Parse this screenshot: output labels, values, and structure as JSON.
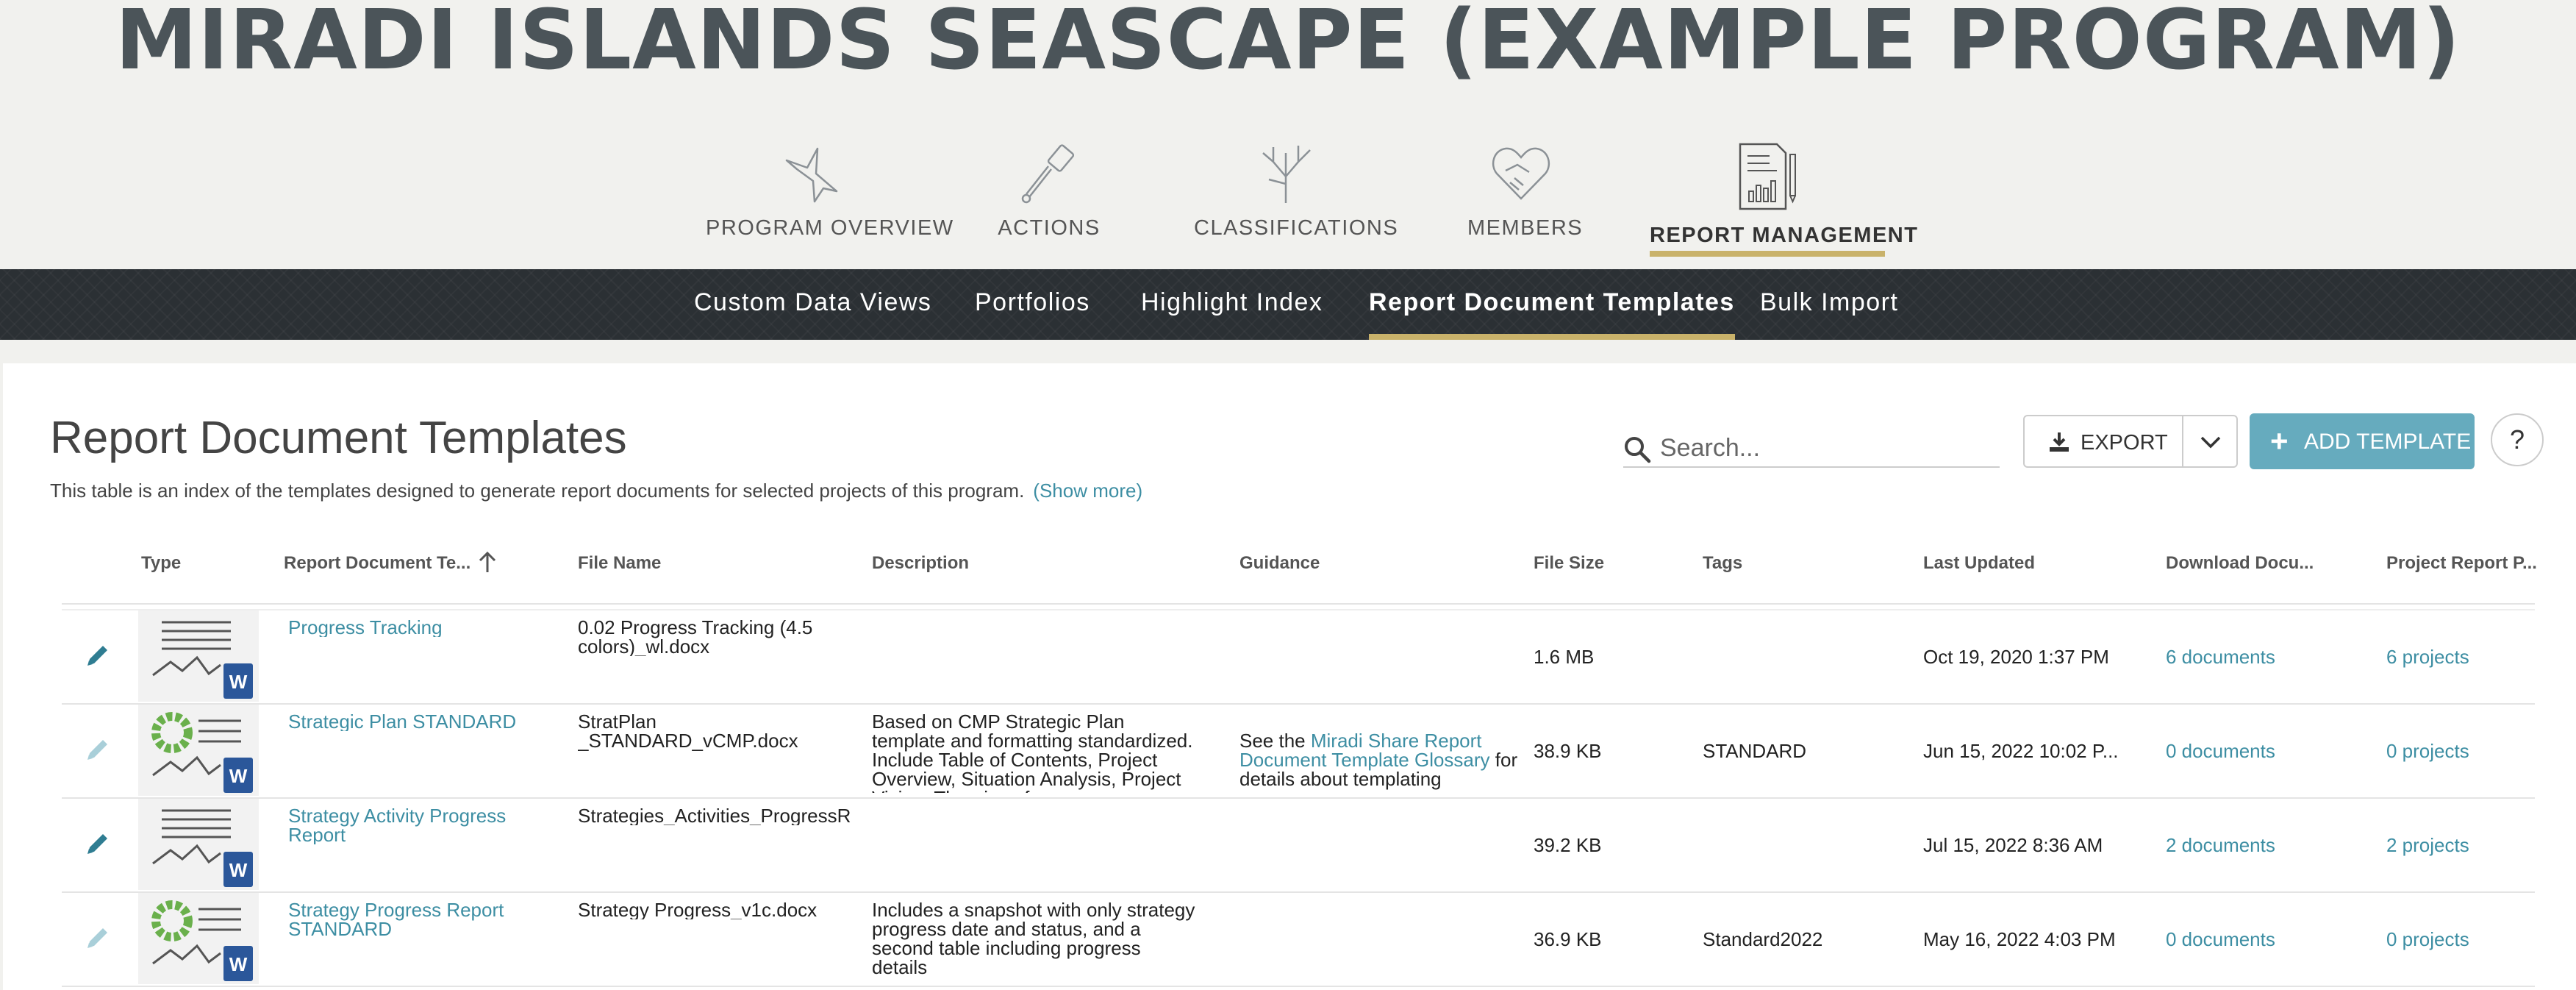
{
  "program_title": "MIRADI ISLANDS SEASCAPE (EXAMPLE PROGRAM)",
  "main_nav": [
    {
      "label": "PROGRAM OVERVIEW",
      "icon": "bird-icon"
    },
    {
      "label": "ACTIONS",
      "icon": "trowel-icon"
    },
    {
      "label": "CLASSIFICATIONS",
      "icon": "branches-icon"
    },
    {
      "label": "MEMBERS",
      "icon": "handshake-icon"
    },
    {
      "label": "REPORT MANAGEMENT",
      "icon": "report-icon",
      "active": true
    }
  ],
  "sub_nav": [
    {
      "label": "Custom Data Views"
    },
    {
      "label": "Portfolios"
    },
    {
      "label": "Highlight Index"
    },
    {
      "label": "Report Document Templates",
      "active": true
    },
    {
      "label": "Bulk Import"
    }
  ],
  "page": {
    "title": "Report Document Templates",
    "description": "This table is an index of the templates designed to generate report documents for selected projects of this program.",
    "show_more": "(Show more)"
  },
  "toolbar": {
    "search_placeholder": "Search...",
    "export_label": "EXPORT",
    "add_label": "ADD TEMPLATE",
    "help_label": "?"
  },
  "table": {
    "columns": [
      "Type",
      "Report Document Te...",
      "File Name",
      "Description",
      "Guidance",
      "File Size",
      "Tags",
      "Last Updated",
      "Download Docu...",
      "Project Report P..."
    ],
    "sort_column": "Report Document Te...",
    "rows": [
      {
        "name": "Progress Tracking",
        "file_name": "0.02 Progress Tracking (4.5 colors)_wl.docx",
        "description": "",
        "guidance": {
          "pre": "",
          "link": "",
          "post": ""
        },
        "file_size": "1.6 MB",
        "tags": "",
        "last_updated": "Oct 19, 2020 1:37 PM",
        "downloads": "6 documents",
        "projects": "6 projects",
        "thumb": "lines",
        "edit_enabled": true
      },
      {
        "name": "Strategic Plan STANDARD",
        "file_name": "StratPlan _STANDARD_vCMP.docx",
        "description": "Based on CMP Strategic Plan template and formatting standardized. Include Table of Contents, Project Overview, Situation Analysis, Project Vision, Theories of",
        "guidance": {
          "pre": "See the ",
          "link": "Miradi Share Report Document Template Glossary",
          "post": " for details about templating"
        },
        "file_size": "38.9 KB",
        "tags": "STANDARD",
        "last_updated": "Jun 15, 2022 10:02 P...",
        "downloads": "0 documents",
        "projects": "0 projects",
        "thumb": "donut",
        "edit_enabled": false
      },
      {
        "name": "Strategy Activity Progress Report",
        "file_name": "Strategies_Activities_ProgressR",
        "description": "",
        "guidance": {
          "pre": "",
          "link": "",
          "post": ""
        },
        "file_size": "39.2 KB",
        "tags": "",
        "last_updated": "Jul 15, 2022 8:36 AM",
        "downloads": "2 documents",
        "projects": "2 projects",
        "thumb": "lines",
        "edit_enabled": true
      },
      {
        "name": "Strategy Progress Report STANDARD",
        "file_name": "Strategy Progress_v1c.docx",
        "description": "Includes a snapshot with only strategy progress date and status, and a second table including progress details",
        "guidance": {
          "pre": "",
          "link": "",
          "post": ""
        },
        "file_size": "36.9 KB",
        "tags": "Standard2022",
        "last_updated": "May 16, 2022 4:03 PM",
        "downloads": "0 documents",
        "projects": "0 projects",
        "thumb": "donut",
        "edit_enabled": false
      }
    ]
  },
  "colors": {
    "accent_gold": "#c9b26a",
    "link_teal": "#3d8ea3",
    "button_teal": "#66abbe",
    "subnav_dark": "#2b3034",
    "word_blue": "#2b579a",
    "donut_green": "#6ab04c"
  }
}
